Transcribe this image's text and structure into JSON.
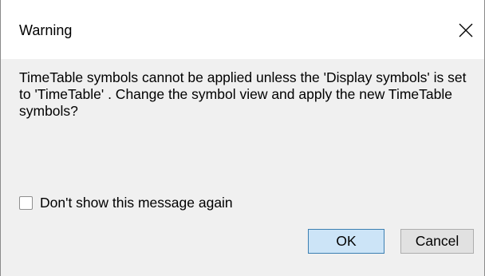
{
  "dialog": {
    "title": "Warning",
    "close_icon": "close-icon",
    "message": "TimeTable symbols cannot be applied unless the 'Display symbols' is set to 'TimeTable' . Change the symbol view and apply the new TimeTable symbols?",
    "checkbox": {
      "label": "Don't show this message again",
      "checked": false
    },
    "buttons": {
      "ok_label": "OK",
      "cancel_label": "Cancel"
    }
  },
  "colors": {
    "ok_button_bg": "#cce4f7",
    "ok_button_border": "#3c7fb1",
    "cancel_button_bg": "#e1e1e1",
    "client_bg": "#f0f0f0"
  }
}
